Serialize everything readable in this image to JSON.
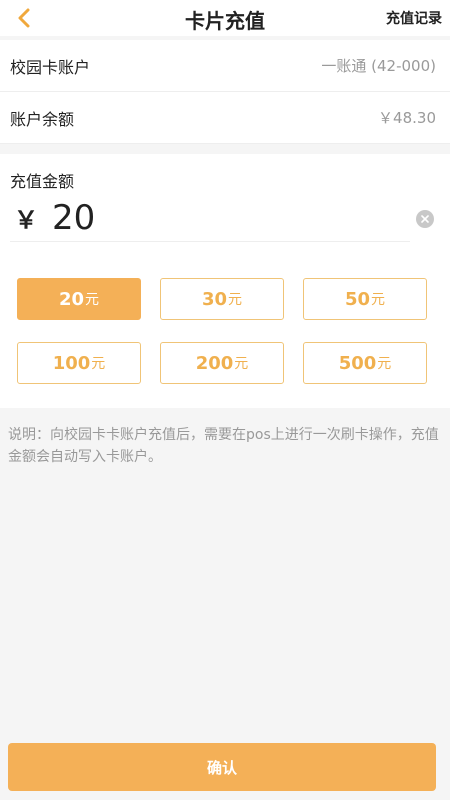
{
  "header": {
    "title": "卡片充值",
    "history_label": "充值记录",
    "back_icon": "chevron-left-icon"
  },
  "account": {
    "rows": [
      {
        "label": "校园卡账户",
        "value": "一账通 (42-000)"
      },
      {
        "label": "账户余额",
        "value": "￥48.30"
      }
    ]
  },
  "recharge": {
    "label": "充值金额",
    "currency": "￥",
    "amount": "20",
    "clear_icon": "clear-icon"
  },
  "presets": [
    {
      "amount": "20",
      "unit": "元",
      "selected": true
    },
    {
      "amount": "30",
      "unit": "元",
      "selected": false
    },
    {
      "amount": "50",
      "unit": "元",
      "selected": false
    },
    {
      "amount": "100",
      "unit": "元",
      "selected": false
    },
    {
      "amount": "200",
      "unit": "元",
      "selected": false
    },
    {
      "amount": "500",
      "unit": "元",
      "selected": false
    }
  ],
  "description": "说明：向校园卡卡账户充值后，需要在pos上进行一次刷卡操作，充值金额会自动写入卡账户。",
  "confirm_label": "确认",
  "colors": {
    "accent": "#f4b057",
    "accent_border": "#f0c477",
    "muted_text": "#999999"
  }
}
